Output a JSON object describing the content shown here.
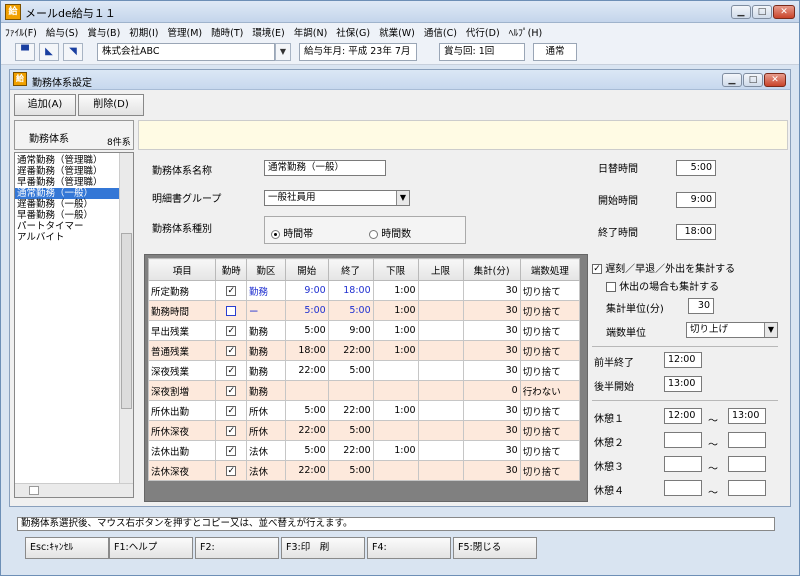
{
  "window": {
    "title": "メールde給与１１",
    "icon_text": "給"
  },
  "menu": [
    "ﾌｧｲﾙ(F)",
    "給与(S)",
    "賞与(B)",
    "初期(I)",
    "管理(M)",
    "随時(T)",
    "環境(E)",
    "年調(N)",
    "社保(G)",
    "就業(W)",
    "通信(C)",
    "代行(D)",
    "ﾍﾙﾌﾟ(H)"
  ],
  "toolbar": {
    "company": "株式会社ABC",
    "pay_month": "給与年月: 平成 23年  7月",
    "bonus": "賞与回: 1回",
    "mode": "通常"
  },
  "child": {
    "title": "勤務体系設定",
    "add_label": "追加(A)",
    "delete_label": "削除(D)"
  },
  "sidebar": {
    "header": "勤務体系",
    "count": "8件系",
    "items": [
      "通常勤務（管理職）",
      "遅番勤務（管理職）",
      "早番勤務（管理職）",
      "通常勤務（一般）",
      "遅番勤務（一般）",
      "早番勤務（一般）",
      "パートタイマー",
      "アルバイト"
    ],
    "selected_index": 3
  },
  "form": {
    "name_label": "勤務体系名称",
    "name_value": "通常勤務（一般）",
    "group_label": "明細書グループ",
    "group_value": "一般社員用",
    "type_label": "勤務体系種別",
    "type_options": [
      "時間帯",
      "時間数"
    ],
    "type_selected": "時間帯",
    "daily_hours_label": "日替時間",
    "daily_hours": "5:00",
    "start_label": "開始時間",
    "start_time": "9:00",
    "end_label": "終了時間",
    "end_time": "18:00"
  },
  "table": {
    "headers": [
      "項目",
      "勤時",
      "勤区",
      "開始",
      "終了",
      "下限",
      "上限",
      "集計(分)",
      "端数処理"
    ],
    "rows": [
      {
        "item": "所定勤務",
        "checked": true,
        "ku": "勤務",
        "start": "9:00",
        "end": "18:00",
        "lower": "1:00",
        "upper": "",
        "agg": "30",
        "round": "切り捨て",
        "blue": true,
        "alt": false
      },
      {
        "item": "勤務時間",
        "checked": false,
        "ku": "ー",
        "start": "5:00",
        "end": "5:00",
        "lower": "1:00",
        "upper": "",
        "agg": "30",
        "round": "切り捨て",
        "blue": true,
        "alt": true
      },
      {
        "item": "早出残業",
        "checked": true,
        "ku": "勤務",
        "start": "5:00",
        "end": "9:00",
        "lower": "1:00",
        "upper": "",
        "agg": "30",
        "round": "切り捨て",
        "blue": false,
        "alt": false
      },
      {
        "item": "普通残業",
        "checked": true,
        "ku": "勤務",
        "start": "18:00",
        "end": "22:00",
        "lower": "1:00",
        "upper": "",
        "agg": "30",
        "round": "切り捨て",
        "blue": false,
        "alt": true
      },
      {
        "item": "深夜残業",
        "checked": true,
        "ku": "勤務",
        "start": "22:00",
        "end": "5:00",
        "lower": "",
        "upper": "",
        "agg": "30",
        "round": "切り捨て",
        "blue": false,
        "alt": false
      },
      {
        "item": "深夜割増",
        "checked": true,
        "ku": "勤務",
        "start": "",
        "end": "",
        "lower": "",
        "upper": "",
        "agg": "0",
        "round": "行わない",
        "blue": false,
        "alt": true
      },
      {
        "item": "所休出勤",
        "checked": true,
        "ku": "所休",
        "start": "5:00",
        "end": "22:00",
        "lower": "1:00",
        "upper": "",
        "agg": "30",
        "round": "切り捨て",
        "blue": false,
        "alt": false
      },
      {
        "item": "所休深夜",
        "checked": true,
        "ku": "所休",
        "start": "22:00",
        "end": "5:00",
        "lower": "",
        "upper": "",
        "agg": "30",
        "round": "切り捨て",
        "blue": false,
        "alt": true
      },
      {
        "item": "法休出勤",
        "checked": true,
        "ku": "法休",
        "start": "5:00",
        "end": "22:00",
        "lower": "1:00",
        "upper": "",
        "agg": "30",
        "round": "切り捨て",
        "blue": false,
        "alt": false
      },
      {
        "item": "法休深夜",
        "checked": true,
        "ku": "法休",
        "start": "22:00",
        "end": "5:00",
        "lower": "",
        "upper": "",
        "agg": "30",
        "round": "切り捨て",
        "blue": false,
        "alt": true
      }
    ]
  },
  "right": {
    "tardy_label": "遅刻／早退／外出を集計する",
    "tardy_checked": true,
    "holiday_label": "休出の場合も集計する",
    "holiday_checked": false,
    "unit_label": "集計単位(分)",
    "unit_value": "30",
    "rounding_label": "端数単位",
    "rounding_value": "切り上げ",
    "first_half_end_label": "前半終了",
    "first_half_end": "12:00",
    "second_half_start_label": "後半開始",
    "second_half_start": "13:00",
    "breaks": [
      {
        "label": "休憩１",
        "from": "12:00",
        "to": "13:00"
      },
      {
        "label": "休憩２",
        "from": "",
        "to": ""
      },
      {
        "label": "休憩３",
        "from": "",
        "to": ""
      },
      {
        "label": "休憩４",
        "from": "",
        "to": ""
      }
    ],
    "tilde": "～"
  },
  "status": "勤務体系選択後、マウス右ボタンを押すとコピー又は、並べ替えが行えます。",
  "fkeys": [
    "Esc:ｷｬﾝｾﾙ",
    "F1:ヘルプ",
    "F2:",
    "F3:印　刷",
    "F4:",
    "F5:閉じる"
  ],
  "colors": {
    "accent": "#3477d6",
    "row_alt": "#fde9dc",
    "blue_text": "#2030d0"
  }
}
